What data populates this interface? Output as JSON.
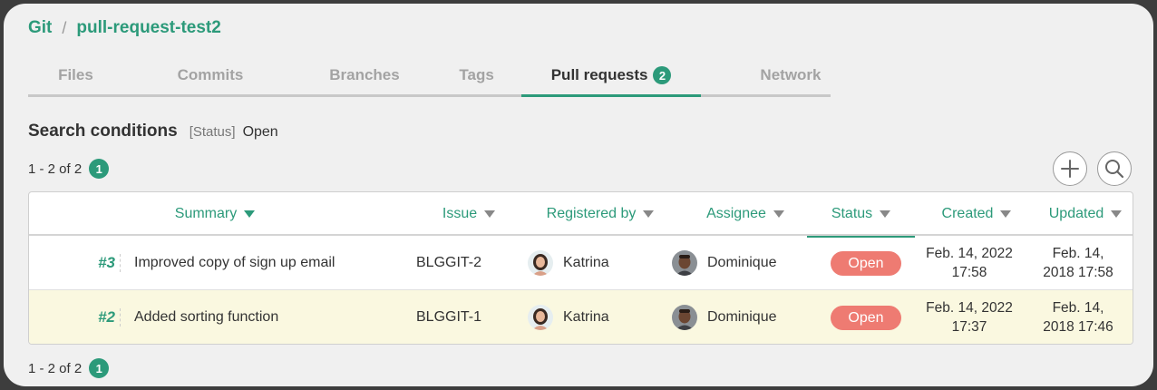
{
  "breadcrumb": {
    "root": "Git",
    "separator": "/",
    "repo": "pull-request-test2"
  },
  "tabs": [
    {
      "label": "Files"
    },
    {
      "label": "Commits"
    },
    {
      "label": "Branches"
    },
    {
      "label": "Tags"
    },
    {
      "label": "Pull requests",
      "badge": "2"
    },
    {
      "label": "Network"
    }
  ],
  "search": {
    "title": "Search conditions",
    "key": "[Status]",
    "value": "Open"
  },
  "pager": {
    "text": "1 - 2 of 2",
    "page": "1"
  },
  "columns": {
    "summary": "Summary",
    "issue": "Issue",
    "registered_by": "Registered by",
    "assignee": "Assignee",
    "status": "Status",
    "created": "Created",
    "updated": "Updated"
  },
  "rows": [
    {
      "id": "#3",
      "summary": "Improved copy of sign up email",
      "issue": "BLGGIT-2",
      "registered_by": "Katrina",
      "assignee": "Dominique",
      "status": "Open",
      "created_date": "Feb. 14, 2022",
      "created_time": "17:58",
      "updated_date": "Feb. 14,",
      "updated_time": "2018 17:58"
    },
    {
      "id": "#2",
      "summary": "Added sorting function",
      "issue": "BLGGIT-1",
      "registered_by": "Katrina",
      "assignee": "Dominique",
      "status": "Open",
      "created_date": "Feb. 14, 2022",
      "created_time": "17:37",
      "updated_date": "Feb. 14,",
      "updated_time": "2018 17:46"
    }
  ],
  "colors": {
    "accent": "#2c9a7a",
    "status_open": "#ee7b72",
    "highlight_row": "#faf8e0"
  }
}
